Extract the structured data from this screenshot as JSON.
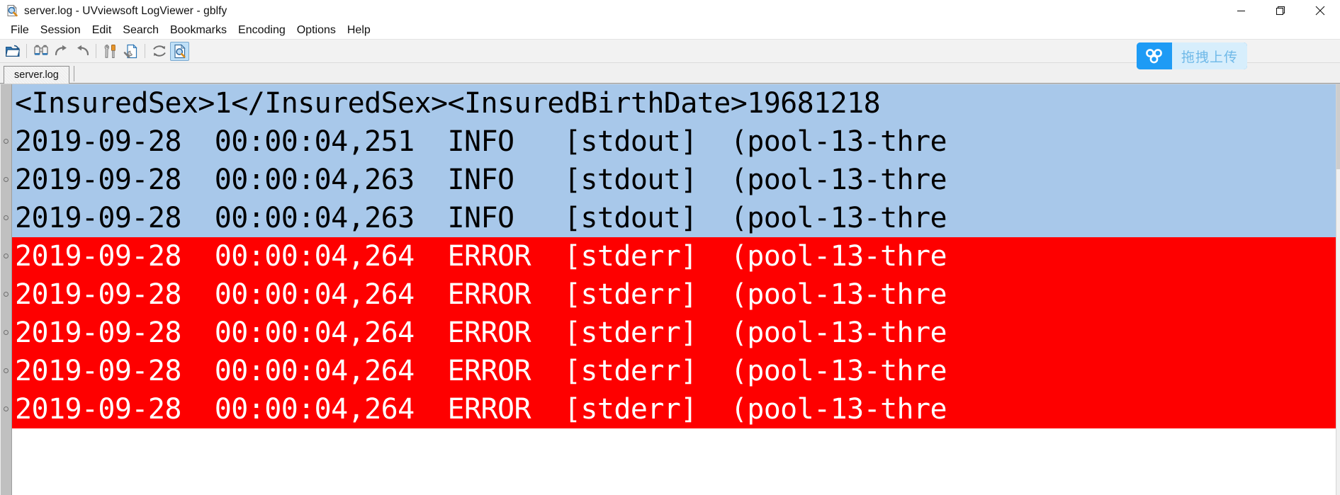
{
  "window": {
    "title": "server.log - UVviewsoft LogViewer - gblfy",
    "icon": "logviewer-magnifier-document-icon",
    "controls": [
      {
        "name": "minimize",
        "glyph": "minimize-icon"
      },
      {
        "name": "restore",
        "glyph": "restore-icon"
      },
      {
        "name": "close",
        "glyph": "close-icon"
      }
    ]
  },
  "menubar": {
    "items": [
      {
        "label": "File"
      },
      {
        "label": "Session"
      },
      {
        "label": "Edit"
      },
      {
        "label": "Search"
      },
      {
        "label": "Bookmarks"
      },
      {
        "label": "Encoding"
      },
      {
        "label": "Options"
      },
      {
        "label": "Help"
      }
    ]
  },
  "toolbar": {
    "buttons": [
      {
        "name": "open-file-icon",
        "active": false
      },
      {
        "sep": true
      },
      {
        "name": "binoculars-find-icon",
        "active": false
      },
      {
        "name": "redo-arrow-icon",
        "active": false
      },
      {
        "name": "undo-arrow-icon",
        "active": false
      },
      {
        "sep": true
      },
      {
        "name": "tools-options-icon",
        "active": false
      },
      {
        "name": "document-settings-icon",
        "active": false
      },
      {
        "sep": true
      },
      {
        "name": "refresh-reload-icon",
        "active": false
      },
      {
        "name": "document-preview-icon",
        "active": true
      }
    ],
    "upload_badge": {
      "icon": "baidu-netdisk-icon",
      "label": "拖拽上传"
    }
  },
  "tabs": [
    {
      "label": "server.log",
      "active": true
    }
  ],
  "log": {
    "colors": {
      "info_bg": "#a8c8ea",
      "info_fg": "#000000",
      "error_bg": "#fe0000",
      "error_fg": "#ffffff",
      "gutter_bg": "#c0c0c0"
    },
    "lines": [
      {
        "level": "info",
        "bookmark": false,
        "text": "<InsuredSex>1</InsuredSex><InsuredBirthDate>19681218"
      },
      {
        "level": "info",
        "bookmark": true,
        "text": "2019-09-28  00:00:04,251  INFO   [stdout]  (pool-13-thre"
      },
      {
        "level": "info",
        "bookmark": true,
        "text": "2019-09-28  00:00:04,263  INFO   [stdout]  (pool-13-thre"
      },
      {
        "level": "info",
        "bookmark": true,
        "text": "2019-09-28  00:00:04,263  INFO   [stdout]  (pool-13-thre"
      },
      {
        "level": "error",
        "bookmark": false,
        "text": "2019-09-28  00:00:04,264  ERROR  [stderr]  (pool-13-thre"
      },
      {
        "level": "error",
        "bookmark": true,
        "text": "2019-09-28  00:00:04,264  ERROR  [stderr]  (pool-13-thre"
      },
      {
        "level": "error",
        "bookmark": true,
        "text": "2019-09-28  00:00:04,264  ERROR  [stderr]  (pool-13-thre"
      },
      {
        "level": "error",
        "bookmark": true,
        "text": "2019-09-28  00:00:04,264  ERROR  [stderr]  (pool-13-thre"
      },
      {
        "level": "error",
        "bookmark": true,
        "text": "2019-09-28  00:00:04,264  ERROR  [stderr]  (pool-13-thre"
      }
    ]
  }
}
